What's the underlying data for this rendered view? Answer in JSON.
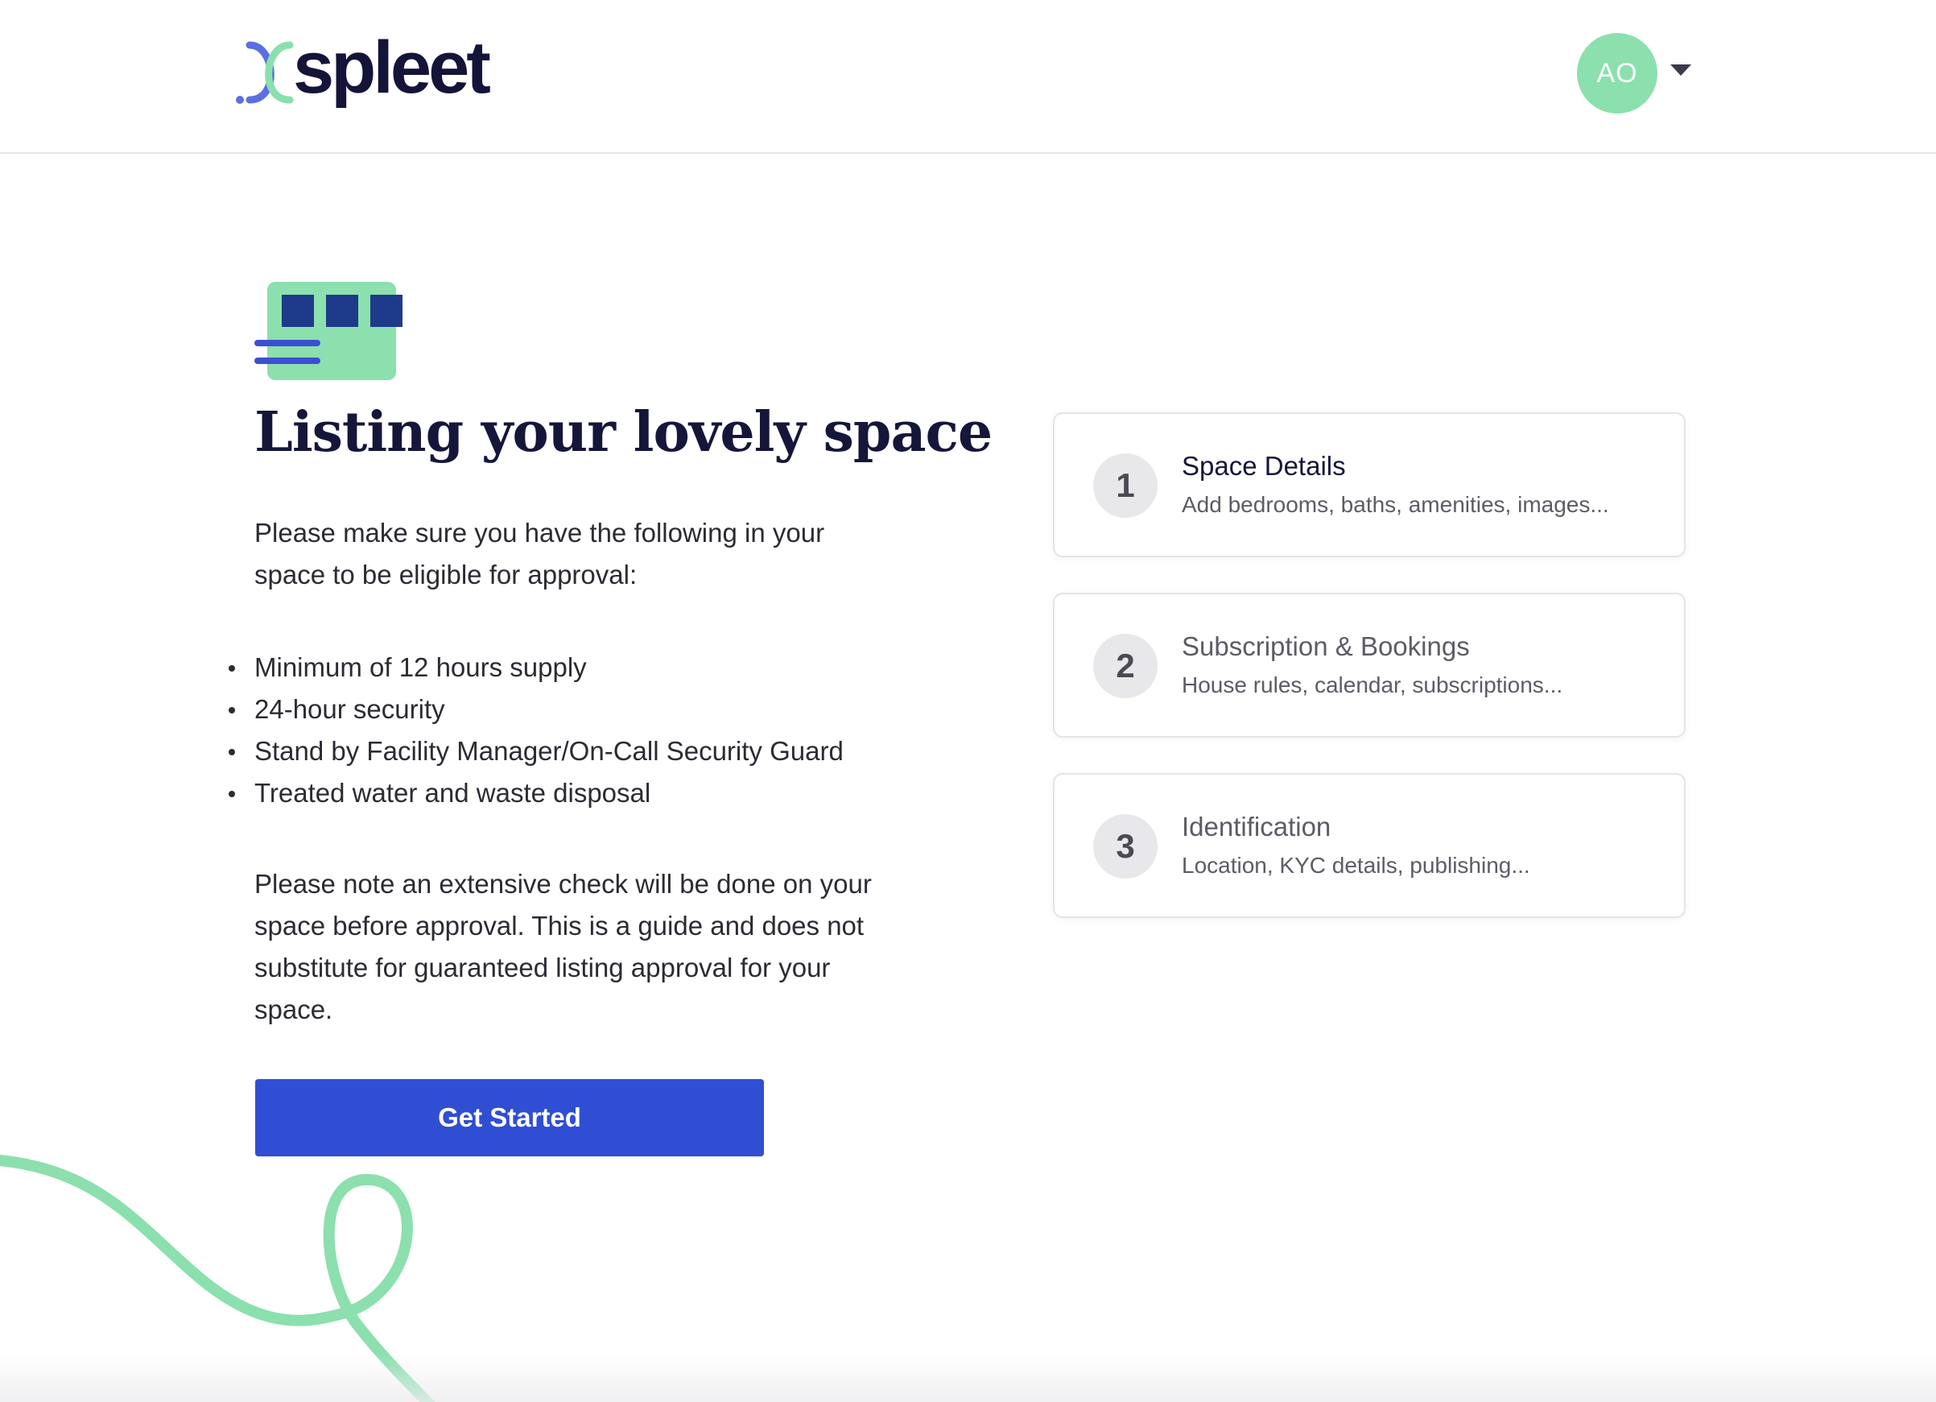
{
  "header": {
    "logo_text": "spleet",
    "avatar_initials": "AO"
  },
  "main": {
    "title": "Listing your lovely space",
    "intro": "Please make sure you have the following in your space to be eligible for approval:",
    "requirements": [
      "Minimum of 12 hours supply",
      "24-hour security",
      "Stand by Facility Manager/On-Call Security Guard",
      "Treated water and waste disposal"
    ],
    "note": "Please note an extensive check will be done on your space before approval. This is a guide and does not substitute for guaranteed listing approval for your space.",
    "cta_label": "Get Started"
  },
  "steps": [
    {
      "number": "1",
      "title": "Space Details",
      "subtitle": "Add bedrooms, baths, amenities, images...",
      "active": true
    },
    {
      "number": "2",
      "title": "Subscription & Bookings",
      "subtitle": "House rules, calendar, subscriptions...",
      "active": false
    },
    {
      "number": "3",
      "title": "Identification",
      "subtitle": "Location, KYC details, publishing...",
      "active": false
    }
  ],
  "colors": {
    "brand_blue": "#304ed3",
    "brand_green": "#8be0ad",
    "navy": "#15163a",
    "icon_blue": "#1e3a8a"
  }
}
